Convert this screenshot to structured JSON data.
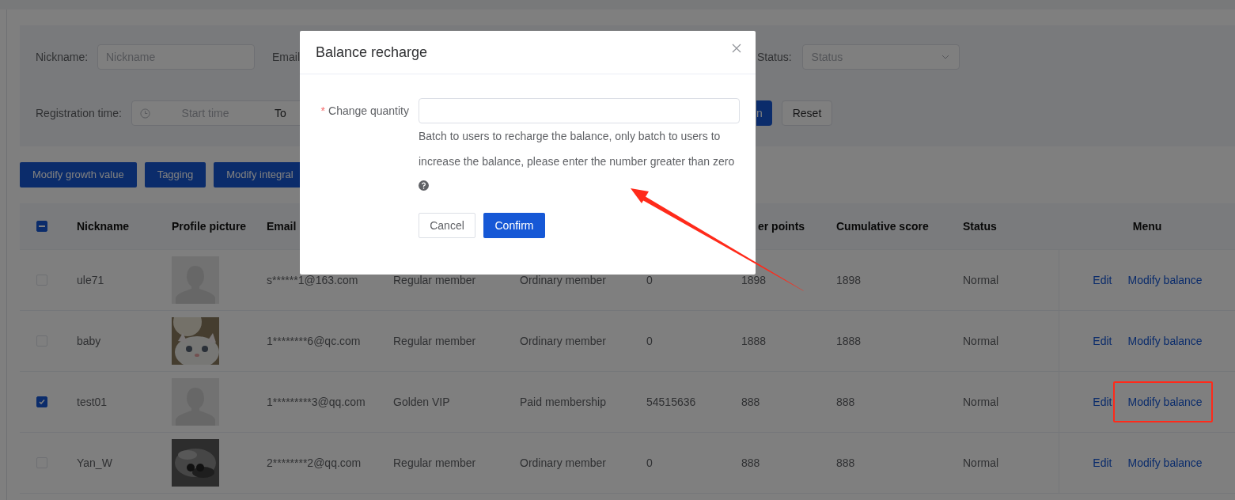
{
  "filters": {
    "nickname": {
      "label": "Nickname:",
      "placeholder": "Nickname"
    },
    "email": {
      "label": "Email"
    },
    "status": {
      "label": "Status:",
      "placeholder": "Status"
    },
    "registration": {
      "label": "Registration time:",
      "start_placeholder": "Start time",
      "separator": "To"
    },
    "search_button": "n",
    "reset_button": "Reset"
  },
  "actions": [
    "Modify growth value",
    "Tagging",
    "Modify integral"
  ],
  "table": {
    "header_checkbox": {
      "indeterminate": true
    },
    "columns": [
      {
        "label": "Nickname"
      },
      {
        "label": "Profile picture"
      },
      {
        "label": "Email"
      },
      {
        "label": "er points"
      },
      {
        "label": "Cumulative score"
      },
      {
        "label": "Status"
      },
      {
        "label": "Menu"
      }
    ],
    "rows": [
      {
        "checked": false,
        "nickname": "ule71",
        "avatar": {
          "kind": "placeholder"
        },
        "email": "s******1@163.com",
        "level": "Regular member",
        "type": "Ordinary member",
        "balance": "0",
        "points": "1898",
        "score": "1898",
        "status": "Normal",
        "menu": [
          "Edit",
          "Modify balance"
        ],
        "highlighted": false
      },
      {
        "checked": false,
        "nickname": "baby",
        "avatar": {
          "kind": "picture"
        },
        "email": "1********6@qc.com",
        "level": "Regular member",
        "type": "Ordinary member",
        "balance": "0",
        "points": "1888",
        "score": "1888",
        "status": "Normal",
        "menu": [
          "Edit",
          "Modify balance"
        ],
        "highlighted": false
      },
      {
        "checked": true,
        "nickname": "test01",
        "avatar": {
          "kind": "placeholder"
        },
        "email": "1*********3@qq.com",
        "level": "Golden VIP",
        "type": "Paid membership",
        "balance": "54515636",
        "points": "888",
        "score": "888",
        "status": "Normal",
        "menu": [
          "Edit",
          "Modify balance"
        ],
        "highlighted": true
      },
      {
        "checked": false,
        "nickname": "Yan_W",
        "avatar": {
          "kind": "picture"
        },
        "email": "2********2@qq.com",
        "level": "Regular member",
        "type": "Ordinary member",
        "balance": "0",
        "points": "888",
        "score": "888",
        "status": "Normal",
        "menu": [
          "Edit",
          "Modify balance"
        ],
        "highlighted": false
      }
    ]
  },
  "modal": {
    "title": "Balance recharge",
    "field": {
      "label": "Change quantity",
      "required_mark": "*"
    },
    "help": "Batch to users to recharge the balance, only batch to users to increase the balance, please enter the number greater than zero",
    "buttons": [
      {
        "label": "Cancel",
        "kind": "default"
      },
      {
        "label": "Confirm",
        "kind": "primary"
      }
    ]
  }
}
